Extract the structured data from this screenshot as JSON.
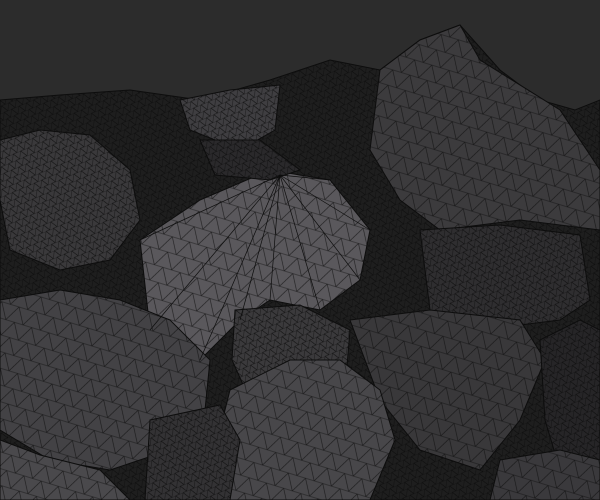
{
  "scene": {
    "subject": "wireframe-rock-pile",
    "colors": {
      "background": "#2c2c2c",
      "rock_dark": "#1e1e1e",
      "rock_mid": "#3c3b3d",
      "rock_light": "#5a585c",
      "wire": "#0d0d0d"
    }
  }
}
